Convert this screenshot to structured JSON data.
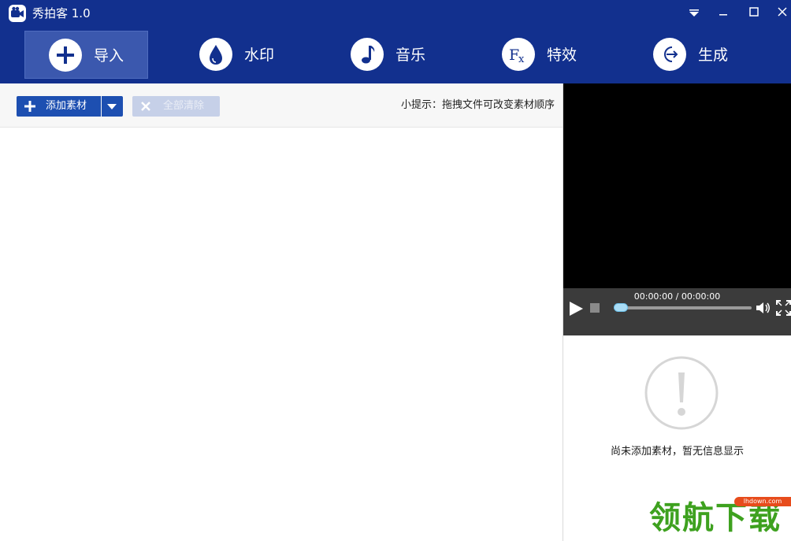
{
  "window": {
    "title": "秀拍客 1.0",
    "controls": [
      "menu-dropdown-icon",
      "minimize-icon",
      "maximize-icon",
      "close-icon"
    ]
  },
  "nav": {
    "items": [
      {
        "label": "导入",
        "icon": "plus-icon",
        "active": true
      },
      {
        "label": "水印",
        "icon": "droplet-icon",
        "active": false
      },
      {
        "label": "音乐",
        "icon": "music-note-icon",
        "active": false
      },
      {
        "label": "特效",
        "icon": "fx-icon",
        "active": false
      },
      {
        "label": "生成",
        "icon": "export-arrow-icon",
        "active": false
      }
    ]
  },
  "toolbar": {
    "add_label": "添加素材",
    "clear_label": "全部清除",
    "clear_enabled": false,
    "hint": "小提示：拖拽文件可改变素材顺序"
  },
  "player": {
    "time": "00:00:00 / 00:00:00",
    "progress": 0
  },
  "info": {
    "icon": "exclamation-circle-icon",
    "message": "尚未添加素材，暂无信息显示"
  },
  "watermark": {
    "text": "领航下载",
    "url": "lhdown.com"
  },
  "colors": {
    "header_blue": "#12308e",
    "active_nav": "#3b58ae",
    "button_blue": "#1d4fb1",
    "disabled_button": "#c6d0e8",
    "player_bar": "#3b3b3b",
    "watermark_green": "#3ea11f"
  }
}
